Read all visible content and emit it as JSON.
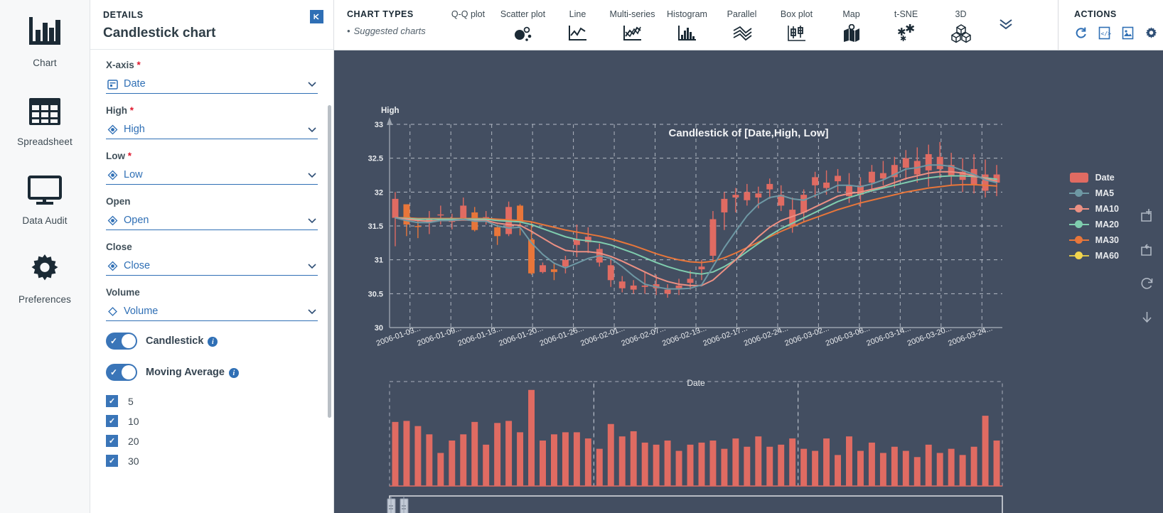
{
  "rail": {
    "items": [
      {
        "label": "Chart",
        "icon": "bar-chart-icon"
      },
      {
        "label": "Spreadsheet",
        "icon": "grid-table-icon"
      },
      {
        "label": "Data Audit",
        "icon": "monitor-icon"
      },
      {
        "label": "Preferences",
        "icon": "gear-icon"
      }
    ]
  },
  "details": {
    "kicker": "DETAILS",
    "title": "Candlestick chart",
    "collapse_icon": "collapse-panel-icon",
    "fields": [
      {
        "label": "X-axis",
        "required": true,
        "value": "Date",
        "icon": "calendar-icon"
      },
      {
        "label": "High",
        "required": true,
        "value": "High",
        "icon": "measure-icon"
      },
      {
        "label": "Low",
        "required": true,
        "value": "Low",
        "icon": "measure-icon"
      },
      {
        "label": "Open",
        "required": false,
        "value": "Open",
        "icon": "measure-icon"
      },
      {
        "label": "Close",
        "required": false,
        "value": "Close",
        "icon": "measure-icon"
      },
      {
        "label": "Volume",
        "required": false,
        "value": "Volume",
        "icon": "diamond-icon"
      }
    ],
    "toggles": [
      {
        "label": "Candlestick",
        "on": true
      },
      {
        "label": "Moving Average",
        "on": true
      }
    ],
    "ma_options": [
      {
        "label": "5",
        "checked": true
      },
      {
        "label": "10",
        "checked": true
      },
      {
        "label": "20",
        "checked": true
      },
      {
        "label": "30",
        "checked": true
      }
    ]
  },
  "chart_types": {
    "title": "CHART TYPES",
    "subtitle": "Suggested charts",
    "items": [
      {
        "label": "Q-Q plot",
        "icon": "qq-plot-icon"
      },
      {
        "label": "Scatter plot",
        "icon": "scatter-plot-icon"
      },
      {
        "label": "Line",
        "icon": "line-chart-icon"
      },
      {
        "label": "Multi-series",
        "icon": "multi-series-icon"
      },
      {
        "label": "Histogram",
        "icon": "histogram-icon"
      },
      {
        "label": "Parallel",
        "icon": "parallel-coordinates-icon"
      },
      {
        "label": "Box plot",
        "icon": "box-plot-icon"
      },
      {
        "label": "Map",
        "icon": "map-icon"
      },
      {
        "label": "t-SNE",
        "icon": "tsne-icon"
      },
      {
        "label": "3D",
        "icon": "cube-3d-icon"
      }
    ],
    "more_icon": "chevron-double-down-icon"
  },
  "actions": {
    "title": "ACTIONS",
    "items": [
      {
        "icon": "refresh-icon",
        "color": "#2f6fb5"
      },
      {
        "icon": "code-document-icon",
        "color": "#2f6fb5"
      },
      {
        "icon": "image-export-icon",
        "color": "#2f6fb5"
      },
      {
        "icon": "gear-icon",
        "color": "#2f4f76"
      }
    ]
  },
  "canvas_tools": [
    {
      "icon": "zoom-area-icon"
    },
    {
      "icon": "restore-zoom-icon"
    },
    {
      "icon": "reset-icon"
    },
    {
      "icon": "download-icon"
    }
  ],
  "chart_data": {
    "type": "candlestick",
    "title": "Candlestick of [Date,High, Low]",
    "xlabel": "Date",
    "ylabel": "High",
    "ylim": [
      30,
      33
    ],
    "yticks": [
      "30",
      "30.5",
      "31",
      "31.5",
      "32",
      "32.5",
      "33"
    ],
    "grid": true,
    "background": "#434e61",
    "legend_position": "right",
    "xtick_labels": [
      "2006-01-03...",
      "2006-01-09...",
      "2006-01-13...",
      "2006-01-20...",
      "2006-01-26...",
      "2006-02-01...",
      "2006-02-07...",
      "2006-02-13...",
      "2006-02-17...",
      "2006-02-24...",
      "2006-03-02...",
      "2006-03-08...",
      "2006-03-14...",
      "2006-03-20...",
      "2006-03-24..."
    ],
    "legend": [
      {
        "name": "Date",
        "color": "#e06b62",
        "marker": "bar"
      },
      {
        "name": "MA5",
        "color": "#6e98a4",
        "marker": "line"
      },
      {
        "name": "MA10",
        "color": "#ec9083",
        "marker": "line"
      },
      {
        "name": "MA20",
        "color": "#7fcdae",
        "marker": "line"
      },
      {
        "name": "MA30",
        "color": "#e8763a",
        "marker": "line"
      },
      {
        "name": "MA60",
        "color": "#f2d54e",
        "marker": "line"
      }
    ],
    "colors": {
      "up": "#e06b62",
      "down": "#e8763a"
    },
    "candles": [
      {
        "o": 31.9,
        "h": 32.0,
        "l": 31.2,
        "c": 31.62,
        "d": "up"
      },
      {
        "o": 31.82,
        "h": 31.82,
        "l": 31.35,
        "c": 31.52,
        "d": "down"
      },
      {
        "o": 31.5,
        "h": 31.62,
        "l": 31.32,
        "c": 31.5,
        "d": "down"
      },
      {
        "o": 31.62,
        "h": 31.72,
        "l": 31.38,
        "c": 31.55,
        "d": "up"
      },
      {
        "o": 31.67,
        "h": 31.8,
        "l": 31.52,
        "c": 31.66,
        "d": "up"
      },
      {
        "o": 31.6,
        "h": 31.68,
        "l": 31.45,
        "c": 31.56,
        "d": "up"
      },
      {
        "o": 31.8,
        "h": 31.92,
        "l": 31.6,
        "c": 31.61,
        "d": "up"
      },
      {
        "o": 31.7,
        "h": 31.78,
        "l": 31.42,
        "c": 31.44,
        "d": "down"
      },
      {
        "o": 31.63,
        "h": 31.72,
        "l": 31.52,
        "c": 31.57,
        "d": "up"
      },
      {
        "o": 31.48,
        "h": 31.52,
        "l": 31.22,
        "c": 31.35,
        "d": "down"
      },
      {
        "o": 31.78,
        "h": 31.86,
        "l": 31.35,
        "c": 31.38,
        "d": "up"
      },
      {
        "o": 31.8,
        "h": 31.82,
        "l": 31.36,
        "c": 31.56,
        "d": "down"
      },
      {
        "o": 31.3,
        "h": 31.56,
        "l": 30.78,
        "c": 30.8,
        "d": "down"
      },
      {
        "o": 30.92,
        "h": 30.96,
        "l": 30.8,
        "c": 30.82,
        "d": "up"
      },
      {
        "o": 30.86,
        "h": 30.94,
        "l": 30.7,
        "c": 30.82,
        "d": "down"
      },
      {
        "o": 31.0,
        "h": 31.06,
        "l": 30.8,
        "c": 30.9,
        "d": "up"
      },
      {
        "o": 31.3,
        "h": 31.52,
        "l": 31.04,
        "c": 31.22,
        "d": "up"
      },
      {
        "o": 31.34,
        "h": 31.48,
        "l": 31.1,
        "c": 31.26,
        "d": "up"
      },
      {
        "o": 31.16,
        "h": 31.24,
        "l": 30.9,
        "c": 30.96,
        "d": "up"
      },
      {
        "o": 30.92,
        "h": 31.0,
        "l": 30.6,
        "c": 30.7,
        "d": "up"
      },
      {
        "o": 30.68,
        "h": 30.76,
        "l": 30.52,
        "c": 30.58,
        "d": "up"
      },
      {
        "o": 30.62,
        "h": 30.7,
        "l": 30.5,
        "c": 30.56,
        "d": "up"
      },
      {
        "o": 30.6,
        "h": 30.82,
        "l": 30.5,
        "c": 30.62,
        "d": "up"
      },
      {
        "o": 30.64,
        "h": 30.78,
        "l": 30.48,
        "c": 30.58,
        "d": "up"
      },
      {
        "o": 30.56,
        "h": 30.64,
        "l": 30.44,
        "c": 30.5,
        "d": "up"
      },
      {
        "o": 30.62,
        "h": 30.72,
        "l": 30.48,
        "c": 30.58,
        "d": "up"
      },
      {
        "o": 30.72,
        "h": 30.84,
        "l": 30.56,
        "c": 30.66,
        "d": "up"
      },
      {
        "o": 30.86,
        "h": 31.0,
        "l": 30.7,
        "c": 30.9,
        "d": "up"
      },
      {
        "o": 31.06,
        "h": 31.72,
        "l": 30.96,
        "c": 31.6,
        "d": "up"
      },
      {
        "o": 31.7,
        "h": 32.0,
        "l": 31.44,
        "c": 31.9,
        "d": "up"
      },
      {
        "o": 31.92,
        "h": 32.06,
        "l": 31.7,
        "c": 31.96,
        "d": "up"
      },
      {
        "o": 32.0,
        "h": 32.12,
        "l": 31.8,
        "c": 31.88,
        "d": "up"
      },
      {
        "o": 31.92,
        "h": 32.08,
        "l": 31.76,
        "c": 31.98,
        "d": "up"
      },
      {
        "o": 32.04,
        "h": 32.2,
        "l": 31.9,
        "c": 32.12,
        "d": "up"
      },
      {
        "o": 31.96,
        "h": 32.1,
        "l": 31.72,
        "c": 31.8,
        "d": "up"
      },
      {
        "o": 31.74,
        "h": 31.92,
        "l": 31.4,
        "c": 31.5,
        "d": "up"
      },
      {
        "o": 31.7,
        "h": 32.04,
        "l": 31.56,
        "c": 31.96,
        "d": "up"
      },
      {
        "o": 32.1,
        "h": 32.3,
        "l": 31.92,
        "c": 32.22,
        "d": "up"
      },
      {
        "o": 32.14,
        "h": 32.32,
        "l": 31.96,
        "c": 32.06,
        "d": "up"
      },
      {
        "o": 32.16,
        "h": 32.34,
        "l": 32.0,
        "c": 32.24,
        "d": "up"
      },
      {
        "o": 32.1,
        "h": 32.28,
        "l": 31.84,
        "c": 31.94,
        "d": "up"
      },
      {
        "o": 31.96,
        "h": 32.22,
        "l": 31.78,
        "c": 32.1,
        "d": "up"
      },
      {
        "o": 32.14,
        "h": 32.4,
        "l": 32.0,
        "c": 32.3,
        "d": "up"
      },
      {
        "o": 32.28,
        "h": 32.46,
        "l": 32.1,
        "c": 32.2,
        "d": "up"
      },
      {
        "o": 32.22,
        "h": 32.52,
        "l": 32.06,
        "c": 32.4,
        "d": "up"
      },
      {
        "o": 32.36,
        "h": 32.62,
        "l": 32.18,
        "c": 32.5,
        "d": "up"
      },
      {
        "o": 32.46,
        "h": 32.66,
        "l": 32.14,
        "c": 32.26,
        "d": "up"
      },
      {
        "o": 32.32,
        "h": 32.7,
        "l": 32.08,
        "c": 32.56,
        "d": "up"
      },
      {
        "o": 32.52,
        "h": 32.74,
        "l": 32.2,
        "c": 32.34,
        "d": "up"
      },
      {
        "o": 32.4,
        "h": 32.58,
        "l": 32.1,
        "c": 32.24,
        "d": "up"
      },
      {
        "o": 32.3,
        "h": 32.5,
        "l": 32.0,
        "c": 32.18,
        "d": "up"
      },
      {
        "o": 32.34,
        "h": 32.56,
        "l": 31.98,
        "c": 32.1,
        "d": "up"
      },
      {
        "o": 32.26,
        "h": 32.48,
        "l": 31.92,
        "c": 32.02,
        "d": "up"
      },
      {
        "o": 32.14,
        "h": 32.4,
        "l": 31.94,
        "c": 32.26,
        "d": "up"
      }
    ],
    "ma5": [
      31.62,
      31.58,
      31.55,
      31.55,
      31.58,
      31.58,
      31.6,
      31.57,
      31.57,
      31.5,
      31.47,
      31.48,
      31.25,
      31.08,
      30.95,
      30.88,
      30.95,
      31.02,
      31.06,
      31.02,
      30.9,
      30.76,
      30.64,
      30.6,
      30.57,
      30.57,
      30.58,
      30.63,
      30.9,
      31.18,
      31.42,
      31.65,
      31.82,
      31.92,
      31.95,
      31.9,
      31.88,
      31.95,
      32.02,
      32.1,
      32.1,
      32.08,
      32.12,
      32.18,
      32.26,
      32.34,
      32.36,
      32.4,
      32.4,
      32.38,
      32.32,
      32.26,
      32.18,
      32.14
    ],
    "ma10": [
      31.62,
      31.6,
      31.58,
      31.57,
      31.58,
      31.58,
      31.59,
      31.58,
      31.58,
      31.54,
      31.52,
      31.51,
      31.42,
      31.32,
      31.22,
      31.14,
      31.12,
      31.12,
      31.1,
      31.05,
      30.98,
      30.9,
      30.82,
      30.74,
      30.68,
      30.64,
      30.62,
      30.62,
      30.7,
      30.85,
      31.0,
      31.18,
      31.34,
      31.48,
      31.58,
      31.64,
      31.7,
      31.78,
      31.86,
      31.94,
      31.98,
      32.0,
      32.04,
      32.08,
      32.14,
      32.2,
      32.24,
      32.28,
      32.3,
      32.3,
      32.28,
      32.24,
      32.2,
      32.16
    ],
    "ma20": [
      31.62,
      31.61,
      31.6,
      31.6,
      31.6,
      31.6,
      31.6,
      31.6,
      31.6,
      31.58,
      31.57,
      31.56,
      31.52,
      31.46,
      31.4,
      31.34,
      31.3,
      31.28,
      31.26,
      31.22,
      31.16,
      31.1,
      31.03,
      30.96,
      30.9,
      30.85,
      30.81,
      30.79,
      30.82,
      30.9,
      31.0,
      31.12,
      31.24,
      31.36,
      31.46,
      31.54,
      31.62,
      31.7,
      31.78,
      31.86,
      31.92,
      31.97,
      32.02,
      32.06,
      32.1,
      32.14,
      32.18,
      32.21,
      32.23,
      32.24,
      32.24,
      32.23,
      32.21,
      32.19
    ],
    "ma30": [
      31.62,
      31.62,
      31.61,
      31.61,
      31.61,
      31.61,
      31.61,
      31.61,
      31.61,
      31.6,
      31.59,
      31.58,
      31.56,
      31.52,
      31.48,
      31.44,
      31.41,
      31.38,
      31.35,
      31.31,
      31.26,
      31.21,
      31.15,
      31.09,
      31.04,
      31.0,
      30.97,
      30.96,
      30.98,
      31.03,
      31.1,
      31.18,
      31.26,
      31.34,
      31.42,
      31.49,
      31.56,
      31.62,
      31.68,
      31.74,
      31.79,
      31.84,
      31.88,
      31.92,
      31.96,
      32.0,
      32.03,
      32.06,
      32.08,
      32.1,
      32.11,
      32.11,
      32.1,
      32.09
    ],
    "volume_bars": [
      0.62,
      0.63,
      0.58,
      0.5,
      0.32,
      0.44,
      0.5,
      0.62,
      0.4,
      0.61,
      0.63,
      0.52,
      0.93,
      0.44,
      0.5,
      0.52,
      0.52,
      0.46,
      0.36,
      0.6,
      0.48,
      0.53,
      0.42,
      0.4,
      0.44,
      0.34,
      0.4,
      0.42,
      0.44,
      0.36,
      0.46,
      0.38,
      0.48,
      0.38,
      0.4,
      0.46,
      0.36,
      0.34,
      0.46,
      0.3,
      0.48,
      0.34,
      0.42,
      0.32,
      0.38,
      0.34,
      0.28,
      0.4,
      0.32,
      0.36,
      0.3,
      0.38,
      0.68,
      0.44
    ],
    "volume_color": "#e06b62",
    "range_slider": {
      "start_pct": 0.2,
      "end_pct": 2.2
    }
  }
}
